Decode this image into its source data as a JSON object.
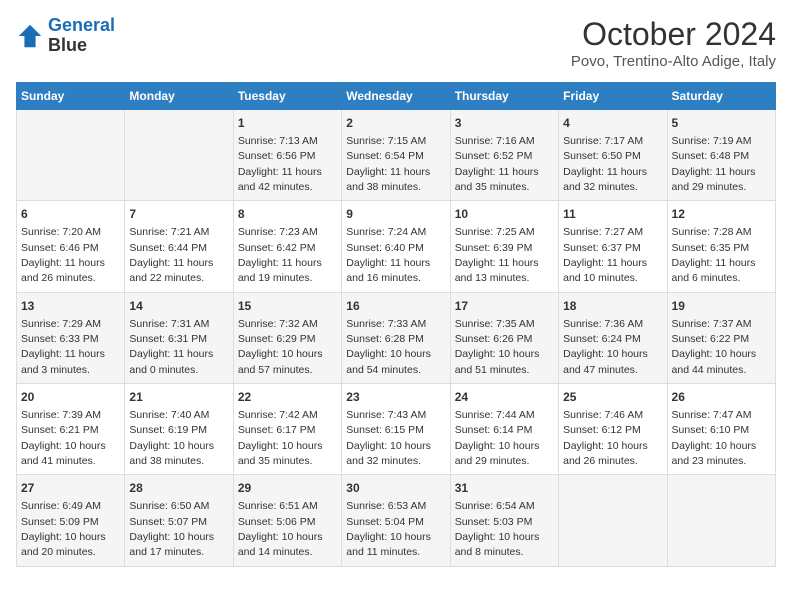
{
  "header": {
    "logo_line1": "General",
    "logo_line2": "Blue",
    "month": "October 2024",
    "location": "Povo, Trentino-Alto Adige, Italy"
  },
  "weekdays": [
    "Sunday",
    "Monday",
    "Tuesday",
    "Wednesday",
    "Thursday",
    "Friday",
    "Saturday"
  ],
  "weeks": [
    [
      {
        "day": "",
        "sunrise": "",
        "sunset": "",
        "daylight": ""
      },
      {
        "day": "",
        "sunrise": "",
        "sunset": "",
        "daylight": ""
      },
      {
        "day": "1",
        "sunrise": "Sunrise: 7:13 AM",
        "sunset": "Sunset: 6:56 PM",
        "daylight": "Daylight: 11 hours and 42 minutes."
      },
      {
        "day": "2",
        "sunrise": "Sunrise: 7:15 AM",
        "sunset": "Sunset: 6:54 PM",
        "daylight": "Daylight: 11 hours and 38 minutes."
      },
      {
        "day": "3",
        "sunrise": "Sunrise: 7:16 AM",
        "sunset": "Sunset: 6:52 PM",
        "daylight": "Daylight: 11 hours and 35 minutes."
      },
      {
        "day": "4",
        "sunrise": "Sunrise: 7:17 AM",
        "sunset": "Sunset: 6:50 PM",
        "daylight": "Daylight: 11 hours and 32 minutes."
      },
      {
        "day": "5",
        "sunrise": "Sunrise: 7:19 AM",
        "sunset": "Sunset: 6:48 PM",
        "daylight": "Daylight: 11 hours and 29 minutes."
      }
    ],
    [
      {
        "day": "6",
        "sunrise": "Sunrise: 7:20 AM",
        "sunset": "Sunset: 6:46 PM",
        "daylight": "Daylight: 11 hours and 26 minutes."
      },
      {
        "day": "7",
        "sunrise": "Sunrise: 7:21 AM",
        "sunset": "Sunset: 6:44 PM",
        "daylight": "Daylight: 11 hours and 22 minutes."
      },
      {
        "day": "8",
        "sunrise": "Sunrise: 7:23 AM",
        "sunset": "Sunset: 6:42 PM",
        "daylight": "Daylight: 11 hours and 19 minutes."
      },
      {
        "day": "9",
        "sunrise": "Sunrise: 7:24 AM",
        "sunset": "Sunset: 6:40 PM",
        "daylight": "Daylight: 11 hours and 16 minutes."
      },
      {
        "day": "10",
        "sunrise": "Sunrise: 7:25 AM",
        "sunset": "Sunset: 6:39 PM",
        "daylight": "Daylight: 11 hours and 13 minutes."
      },
      {
        "day": "11",
        "sunrise": "Sunrise: 7:27 AM",
        "sunset": "Sunset: 6:37 PM",
        "daylight": "Daylight: 11 hours and 10 minutes."
      },
      {
        "day": "12",
        "sunrise": "Sunrise: 7:28 AM",
        "sunset": "Sunset: 6:35 PM",
        "daylight": "Daylight: 11 hours and 6 minutes."
      }
    ],
    [
      {
        "day": "13",
        "sunrise": "Sunrise: 7:29 AM",
        "sunset": "Sunset: 6:33 PM",
        "daylight": "Daylight: 11 hours and 3 minutes."
      },
      {
        "day": "14",
        "sunrise": "Sunrise: 7:31 AM",
        "sunset": "Sunset: 6:31 PM",
        "daylight": "Daylight: 11 hours and 0 minutes."
      },
      {
        "day": "15",
        "sunrise": "Sunrise: 7:32 AM",
        "sunset": "Sunset: 6:29 PM",
        "daylight": "Daylight: 10 hours and 57 minutes."
      },
      {
        "day": "16",
        "sunrise": "Sunrise: 7:33 AM",
        "sunset": "Sunset: 6:28 PM",
        "daylight": "Daylight: 10 hours and 54 minutes."
      },
      {
        "day": "17",
        "sunrise": "Sunrise: 7:35 AM",
        "sunset": "Sunset: 6:26 PM",
        "daylight": "Daylight: 10 hours and 51 minutes."
      },
      {
        "day": "18",
        "sunrise": "Sunrise: 7:36 AM",
        "sunset": "Sunset: 6:24 PM",
        "daylight": "Daylight: 10 hours and 47 minutes."
      },
      {
        "day": "19",
        "sunrise": "Sunrise: 7:37 AM",
        "sunset": "Sunset: 6:22 PM",
        "daylight": "Daylight: 10 hours and 44 minutes."
      }
    ],
    [
      {
        "day": "20",
        "sunrise": "Sunrise: 7:39 AM",
        "sunset": "Sunset: 6:21 PM",
        "daylight": "Daylight: 10 hours and 41 minutes."
      },
      {
        "day": "21",
        "sunrise": "Sunrise: 7:40 AM",
        "sunset": "Sunset: 6:19 PM",
        "daylight": "Daylight: 10 hours and 38 minutes."
      },
      {
        "day": "22",
        "sunrise": "Sunrise: 7:42 AM",
        "sunset": "Sunset: 6:17 PM",
        "daylight": "Daylight: 10 hours and 35 minutes."
      },
      {
        "day": "23",
        "sunrise": "Sunrise: 7:43 AM",
        "sunset": "Sunset: 6:15 PM",
        "daylight": "Daylight: 10 hours and 32 minutes."
      },
      {
        "day": "24",
        "sunrise": "Sunrise: 7:44 AM",
        "sunset": "Sunset: 6:14 PM",
        "daylight": "Daylight: 10 hours and 29 minutes."
      },
      {
        "day": "25",
        "sunrise": "Sunrise: 7:46 AM",
        "sunset": "Sunset: 6:12 PM",
        "daylight": "Daylight: 10 hours and 26 minutes."
      },
      {
        "day": "26",
        "sunrise": "Sunrise: 7:47 AM",
        "sunset": "Sunset: 6:10 PM",
        "daylight": "Daylight: 10 hours and 23 minutes."
      }
    ],
    [
      {
        "day": "27",
        "sunrise": "Sunrise: 6:49 AM",
        "sunset": "Sunset: 5:09 PM",
        "daylight": "Daylight: 10 hours and 20 minutes."
      },
      {
        "day": "28",
        "sunrise": "Sunrise: 6:50 AM",
        "sunset": "Sunset: 5:07 PM",
        "daylight": "Daylight: 10 hours and 17 minutes."
      },
      {
        "day": "29",
        "sunrise": "Sunrise: 6:51 AM",
        "sunset": "Sunset: 5:06 PM",
        "daylight": "Daylight: 10 hours and 14 minutes."
      },
      {
        "day": "30",
        "sunrise": "Sunrise: 6:53 AM",
        "sunset": "Sunset: 5:04 PM",
        "daylight": "Daylight: 10 hours and 11 minutes."
      },
      {
        "day": "31",
        "sunrise": "Sunrise: 6:54 AM",
        "sunset": "Sunset: 5:03 PM",
        "daylight": "Daylight: 10 hours and 8 minutes."
      },
      {
        "day": "",
        "sunrise": "",
        "sunset": "",
        "daylight": ""
      },
      {
        "day": "",
        "sunrise": "",
        "sunset": "",
        "daylight": ""
      }
    ]
  ]
}
